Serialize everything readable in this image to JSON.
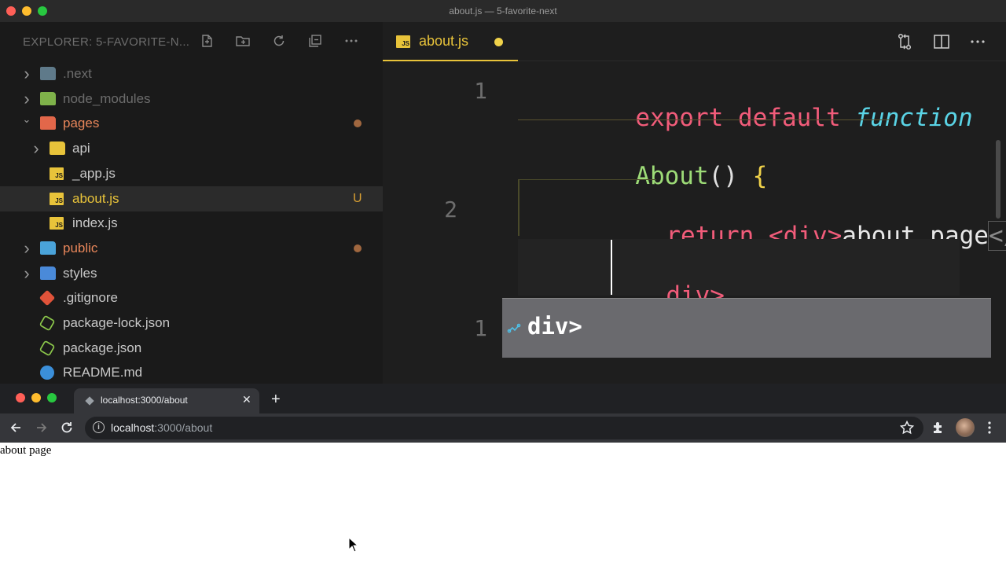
{
  "vscode": {
    "window_title": "about.js — 5-favorite-next",
    "explorer_title": "EXPLORER: 5-FAVORITE-N...",
    "explorer_actions": [
      "new-file-icon",
      "new-folder-icon",
      "refresh-icon",
      "collapse-all-icon",
      "more-icon"
    ],
    "tree": [
      {
        "label": ".next",
        "type": "folder",
        "color": "#5f7a8a",
        "expanded": false,
        "label_color": "#6c6c6c"
      },
      {
        "label": "node_modules",
        "type": "folder",
        "color": "#7fb24a",
        "expanded": false,
        "label_color": "#6c6c6c"
      },
      {
        "label": "pages",
        "type": "folder",
        "color": "#e2674a",
        "expanded": true,
        "label_color": "#e8865a",
        "badge": "dot"
      },
      {
        "label": "api",
        "type": "folder",
        "color": "#e8c33a",
        "expanded": false,
        "label_color": "#c8c8c8"
      },
      {
        "label": "_app.js",
        "type": "js",
        "label_color": "#c8c8c8"
      },
      {
        "label": "about.js",
        "type": "js",
        "label_color": "#e8c33a",
        "badge": "U",
        "selected": true
      },
      {
        "label": "index.js",
        "type": "js",
        "label_color": "#c8c8c8"
      },
      {
        "label": "public",
        "type": "folder",
        "color": "#4aa3d9",
        "expanded": false,
        "label_color": "#e8865a",
        "badge": "dot"
      },
      {
        "label": "styles",
        "type": "folder",
        "color": "#4a8ad9",
        "expanded": false,
        "label_color": "#c8c8c8"
      },
      {
        "label": ".gitignore",
        "type": "git",
        "label_color": "#c8c8c8"
      },
      {
        "label": "package-lock.json",
        "type": "node",
        "label_color": "#c8c8c8"
      },
      {
        "label": "package.json",
        "type": "node",
        "label_color": "#c8c8c8"
      },
      {
        "label": "README.md",
        "type": "info",
        "label_color": "#c8c8c8"
      }
    ],
    "tab": {
      "label": "about.js",
      "dirty": true
    },
    "editor_actions": [
      "compare-changes-icon",
      "split-editor-icon",
      "more-icon"
    ],
    "code": {
      "line1_num": "1",
      "line1_kw1": "export",
      "line1_kw2": "default",
      "line1_fn": "function",
      "line1b_name": "About",
      "line1b_paren": "()",
      "line1b_brace": "{",
      "line2_num": "2",
      "line2_kw": "return",
      "line2_open": "<div>",
      "line2_text": "about page",
      "line2_close_start": "</",
      "line2b_rest": "div>",
      "line3_num": "1"
    },
    "suggestion": {
      "label": "div>"
    },
    "colors": {
      "accent": "#e8c33a",
      "keyword": "#f25c7a",
      "function_kw": "#5ad4e6",
      "name": "#9ddb77"
    }
  },
  "browser": {
    "tab_title": "localhost:3000/about",
    "new_tab": "+",
    "url_host": "localhost",
    "url_path": ":3000/about",
    "page_text": "about page"
  }
}
